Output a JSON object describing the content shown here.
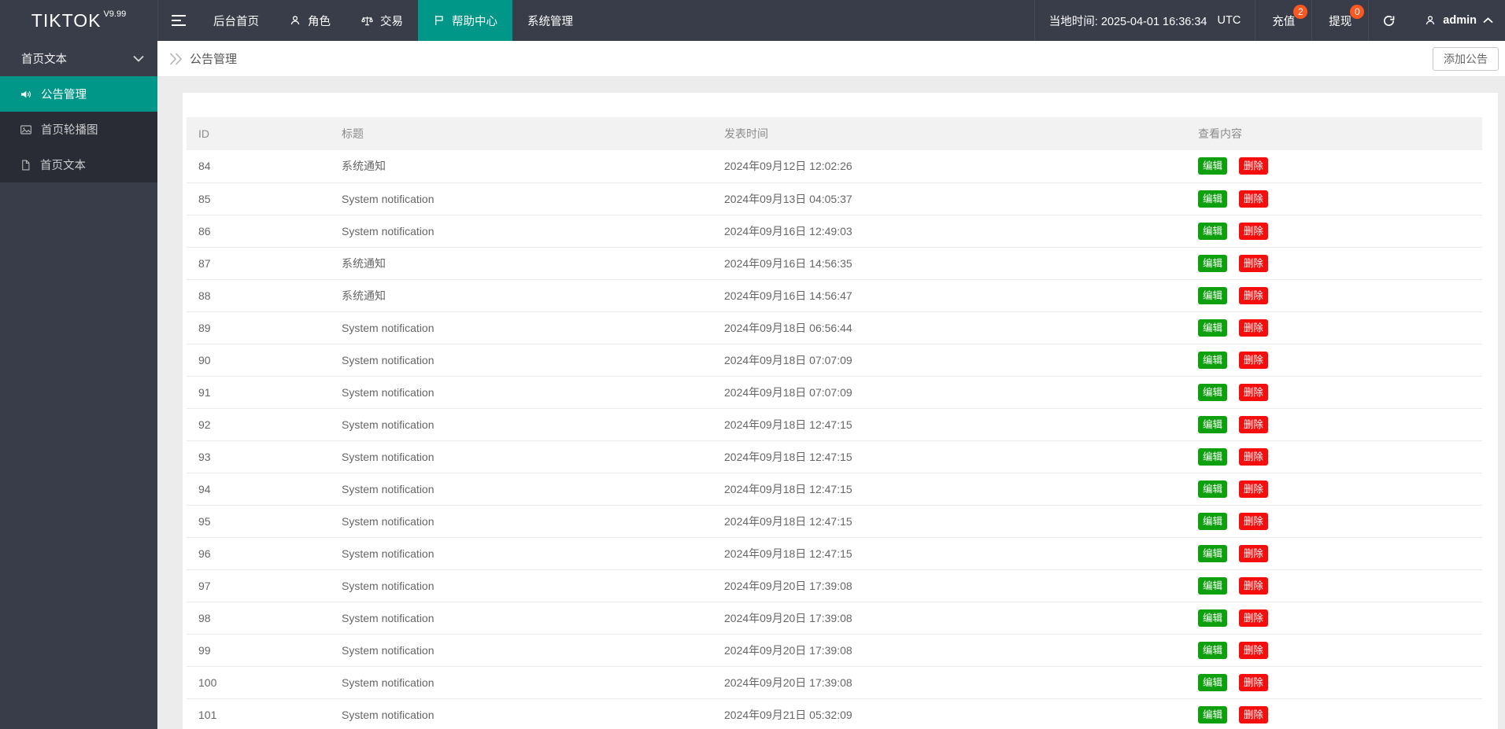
{
  "colors": {
    "accent_teal": "#009688",
    "nav_background": "#393D49",
    "badge_orange": "#FF5722",
    "edit_button_green": "#0FA00F",
    "delete_button_red": "#F40E0E"
  },
  "topbar": {
    "logo": "TIKTOK",
    "version": "V9.99",
    "nav": [
      {
        "label": "后台首页"
      },
      {
        "label": "角色",
        "icon": "user-icon"
      },
      {
        "label": "交易",
        "icon": "scales-icon"
      },
      {
        "label": "帮助中心",
        "icon": "flag-icon",
        "active": true
      },
      {
        "label": "系统管理"
      }
    ],
    "local_time": "当地时间: 2025-04-01 16:36:34",
    "timezone": "UTC",
    "recharge": {
      "label": "充值",
      "badge": "2"
    },
    "withdraw": {
      "label": "提现",
      "badge": "0"
    },
    "username": "admin"
  },
  "sidebar": {
    "group_label": "首页文本",
    "items": [
      {
        "label": "公告管理",
        "icon": "speaker-icon",
        "active": true
      },
      {
        "label": "首页轮播图",
        "icon": "image-icon",
        "active": false
      },
      {
        "label": "首页文本",
        "icon": "file-icon",
        "active": false
      }
    ]
  },
  "breadcrumb": {
    "title": "公告管理"
  },
  "toolbar": {
    "add_label": "添加公告"
  },
  "table": {
    "columns": [
      "ID",
      "标题",
      "发表时间",
      "查看内容"
    ],
    "edit_label": "编辑",
    "delete_label": "删除",
    "rows": [
      {
        "id": "84",
        "title": "系统通知",
        "time": "2024年09月12日 12:02:26"
      },
      {
        "id": "85",
        "title": "System notification",
        "time": "2024年09月13日 04:05:37"
      },
      {
        "id": "86",
        "title": "System notification",
        "time": "2024年09月16日 12:49:03"
      },
      {
        "id": "87",
        "title": "系统通知",
        "time": "2024年09月16日 14:56:35"
      },
      {
        "id": "88",
        "title": "系统通知",
        "time": "2024年09月16日 14:56:47"
      },
      {
        "id": "89",
        "title": "System notification",
        "time": "2024年09月18日 06:56:44"
      },
      {
        "id": "90",
        "title": "System notification",
        "time": "2024年09月18日 07:07:09"
      },
      {
        "id": "91",
        "title": "System notification",
        "time": "2024年09月18日 07:07:09"
      },
      {
        "id": "92",
        "title": "System notification",
        "time": "2024年09月18日 12:47:15"
      },
      {
        "id": "93",
        "title": "System notification",
        "time": "2024年09月18日 12:47:15"
      },
      {
        "id": "94",
        "title": "System notification",
        "time": "2024年09月18日 12:47:15"
      },
      {
        "id": "95",
        "title": "System notification",
        "time": "2024年09月18日 12:47:15"
      },
      {
        "id": "96",
        "title": "System notification",
        "time": "2024年09月18日 12:47:15"
      },
      {
        "id": "97",
        "title": "System notification",
        "time": "2024年09月20日 17:39:08"
      },
      {
        "id": "98",
        "title": "System notification",
        "time": "2024年09月20日 17:39:08"
      },
      {
        "id": "99",
        "title": "System notification",
        "time": "2024年09月20日 17:39:08"
      },
      {
        "id": "100",
        "title": "System notification",
        "time": "2024年09月20日 17:39:08"
      },
      {
        "id": "101",
        "title": "System notification",
        "time": "2024年09月21日 05:32:09"
      }
    ]
  }
}
